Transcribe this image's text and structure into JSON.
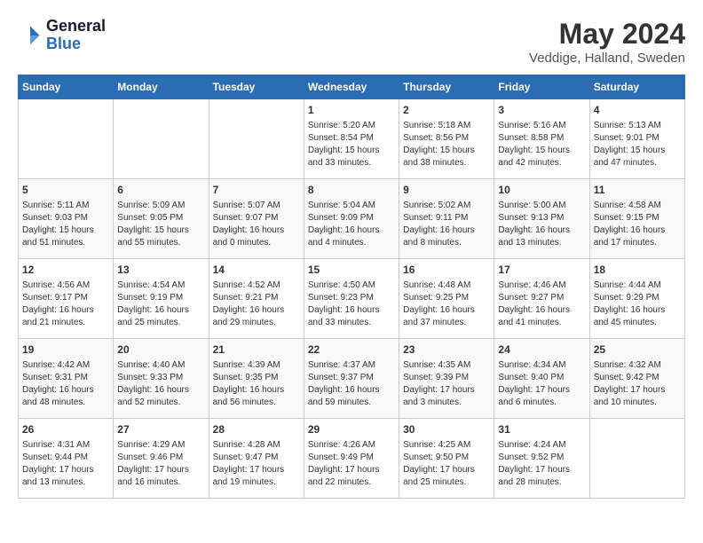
{
  "header": {
    "logo_general": "General",
    "logo_blue": "Blue",
    "title": "May 2024",
    "subtitle": "Veddige, Halland, Sweden"
  },
  "weekdays": [
    "Sunday",
    "Monday",
    "Tuesday",
    "Wednesday",
    "Thursday",
    "Friday",
    "Saturday"
  ],
  "weeks": [
    [
      {
        "day": "",
        "info": ""
      },
      {
        "day": "",
        "info": ""
      },
      {
        "day": "",
        "info": ""
      },
      {
        "day": "1",
        "info": "Sunrise: 5:20 AM\nSunset: 8:54 PM\nDaylight: 15 hours\nand 33 minutes."
      },
      {
        "day": "2",
        "info": "Sunrise: 5:18 AM\nSunset: 8:56 PM\nDaylight: 15 hours\nand 38 minutes."
      },
      {
        "day": "3",
        "info": "Sunrise: 5:16 AM\nSunset: 8:58 PM\nDaylight: 15 hours\nand 42 minutes."
      },
      {
        "day": "4",
        "info": "Sunrise: 5:13 AM\nSunset: 9:01 PM\nDaylight: 15 hours\nand 47 minutes."
      }
    ],
    [
      {
        "day": "5",
        "info": "Sunrise: 5:11 AM\nSunset: 9:03 PM\nDaylight: 15 hours\nand 51 minutes."
      },
      {
        "day": "6",
        "info": "Sunrise: 5:09 AM\nSunset: 9:05 PM\nDaylight: 15 hours\nand 55 minutes."
      },
      {
        "day": "7",
        "info": "Sunrise: 5:07 AM\nSunset: 9:07 PM\nDaylight: 16 hours\nand 0 minutes."
      },
      {
        "day": "8",
        "info": "Sunrise: 5:04 AM\nSunset: 9:09 PM\nDaylight: 16 hours\nand 4 minutes."
      },
      {
        "day": "9",
        "info": "Sunrise: 5:02 AM\nSunset: 9:11 PM\nDaylight: 16 hours\nand 8 minutes."
      },
      {
        "day": "10",
        "info": "Sunrise: 5:00 AM\nSunset: 9:13 PM\nDaylight: 16 hours\nand 13 minutes."
      },
      {
        "day": "11",
        "info": "Sunrise: 4:58 AM\nSunset: 9:15 PM\nDaylight: 16 hours\nand 17 minutes."
      }
    ],
    [
      {
        "day": "12",
        "info": "Sunrise: 4:56 AM\nSunset: 9:17 PM\nDaylight: 16 hours\nand 21 minutes."
      },
      {
        "day": "13",
        "info": "Sunrise: 4:54 AM\nSunset: 9:19 PM\nDaylight: 16 hours\nand 25 minutes."
      },
      {
        "day": "14",
        "info": "Sunrise: 4:52 AM\nSunset: 9:21 PM\nDaylight: 16 hours\nand 29 minutes."
      },
      {
        "day": "15",
        "info": "Sunrise: 4:50 AM\nSunset: 9:23 PM\nDaylight: 16 hours\nand 33 minutes."
      },
      {
        "day": "16",
        "info": "Sunrise: 4:48 AM\nSunset: 9:25 PM\nDaylight: 16 hours\nand 37 minutes."
      },
      {
        "day": "17",
        "info": "Sunrise: 4:46 AM\nSunset: 9:27 PM\nDaylight: 16 hours\nand 41 minutes."
      },
      {
        "day": "18",
        "info": "Sunrise: 4:44 AM\nSunset: 9:29 PM\nDaylight: 16 hours\nand 45 minutes."
      }
    ],
    [
      {
        "day": "19",
        "info": "Sunrise: 4:42 AM\nSunset: 9:31 PM\nDaylight: 16 hours\nand 48 minutes."
      },
      {
        "day": "20",
        "info": "Sunrise: 4:40 AM\nSunset: 9:33 PM\nDaylight: 16 hours\nand 52 minutes."
      },
      {
        "day": "21",
        "info": "Sunrise: 4:39 AM\nSunset: 9:35 PM\nDaylight: 16 hours\nand 56 minutes."
      },
      {
        "day": "22",
        "info": "Sunrise: 4:37 AM\nSunset: 9:37 PM\nDaylight: 16 hours\nand 59 minutes."
      },
      {
        "day": "23",
        "info": "Sunrise: 4:35 AM\nSunset: 9:39 PM\nDaylight: 17 hours\nand 3 minutes."
      },
      {
        "day": "24",
        "info": "Sunrise: 4:34 AM\nSunset: 9:40 PM\nDaylight: 17 hours\nand 6 minutes."
      },
      {
        "day": "25",
        "info": "Sunrise: 4:32 AM\nSunset: 9:42 PM\nDaylight: 17 hours\nand 10 minutes."
      }
    ],
    [
      {
        "day": "26",
        "info": "Sunrise: 4:31 AM\nSunset: 9:44 PM\nDaylight: 17 hours\nand 13 minutes."
      },
      {
        "day": "27",
        "info": "Sunrise: 4:29 AM\nSunset: 9:46 PM\nDaylight: 17 hours\nand 16 minutes."
      },
      {
        "day": "28",
        "info": "Sunrise: 4:28 AM\nSunset: 9:47 PM\nDaylight: 17 hours\nand 19 minutes."
      },
      {
        "day": "29",
        "info": "Sunrise: 4:26 AM\nSunset: 9:49 PM\nDaylight: 17 hours\nand 22 minutes."
      },
      {
        "day": "30",
        "info": "Sunrise: 4:25 AM\nSunset: 9:50 PM\nDaylight: 17 hours\nand 25 minutes."
      },
      {
        "day": "31",
        "info": "Sunrise: 4:24 AM\nSunset: 9:52 PM\nDaylight: 17 hours\nand 28 minutes."
      },
      {
        "day": "",
        "info": ""
      }
    ]
  ]
}
